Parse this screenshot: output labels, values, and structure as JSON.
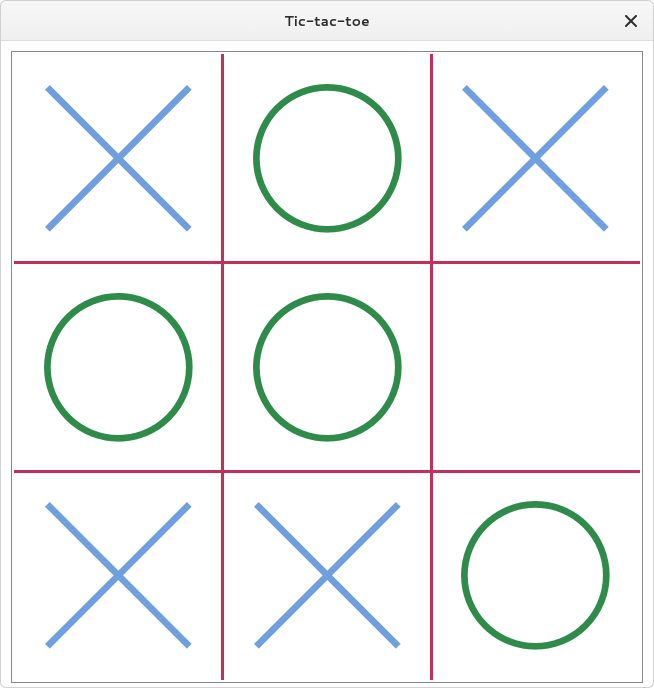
{
  "window": {
    "title": "Tic-tac-toe"
  },
  "colors": {
    "grid": "#c0305b",
    "x": "#6f9fdd",
    "o": "#2f8b4a"
  },
  "board": {
    "cells": [
      [
        "X",
        "O",
        "X"
      ],
      [
        "O",
        "O",
        ""
      ],
      [
        "X",
        "X",
        "O"
      ]
    ]
  }
}
